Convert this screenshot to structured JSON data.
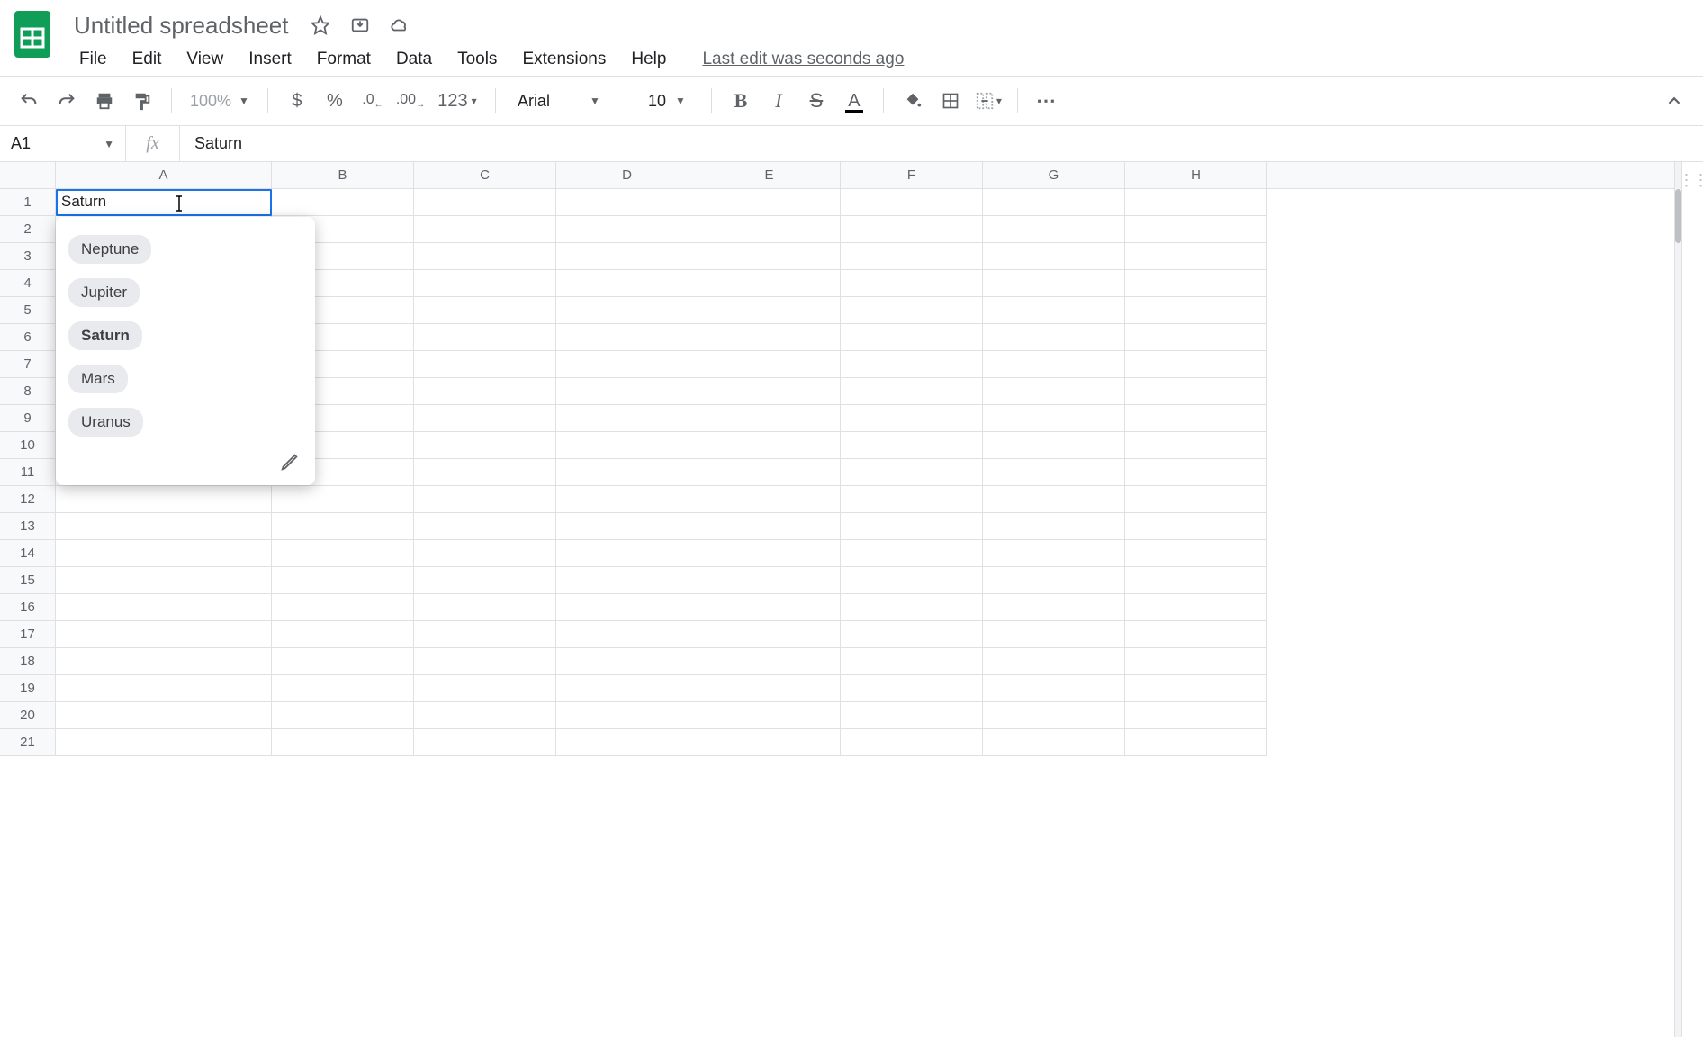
{
  "doc": {
    "title": "Untitled spreadsheet"
  },
  "menubar": {
    "file": "File",
    "edit": "Edit",
    "view": "View",
    "insert": "Insert",
    "format": "Format",
    "data": "Data",
    "tools": "Tools",
    "extensions": "Extensions",
    "help": "Help",
    "last_edit": "Last edit was seconds ago"
  },
  "toolbar": {
    "zoom": "100%",
    "currency": "$",
    "percent": "%",
    "dec_dec": ".0",
    "dec_inc": ".00",
    "more_formats": "123",
    "font": "Arial",
    "size": "10",
    "bold": "B",
    "italic": "I",
    "strike": "S",
    "textcolor": "A"
  },
  "namebox": {
    "ref": "A1",
    "fx": "fx",
    "formula": "Saturn"
  },
  "columns": [
    "A",
    "B",
    "C",
    "D",
    "E",
    "F",
    "G",
    "H"
  ],
  "rows": [
    "1",
    "2",
    "3",
    "4",
    "5",
    "6",
    "7",
    "8",
    "9",
    "10",
    "11",
    "12",
    "13",
    "14",
    "15",
    "16",
    "17",
    "18",
    "19",
    "20",
    "21"
  ],
  "active_cell": {
    "value": "Saturn"
  },
  "dropdown": {
    "options": [
      "Neptune",
      "Jupiter",
      "Saturn",
      "Mars",
      "Uranus"
    ],
    "selected": "Saturn"
  }
}
